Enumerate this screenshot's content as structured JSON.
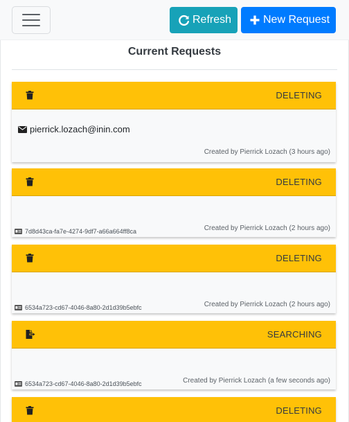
{
  "header": {
    "refresh_label": "Refresh",
    "new_request_label": "New Request"
  },
  "page": {
    "title": "Current Requests"
  },
  "colors": {
    "refresh": "#17a2b8",
    "new_request": "#007bff",
    "card_header": "#ffc107"
  },
  "requests": [
    {
      "status": "DELETING",
      "icon": "trash-icon",
      "email": "pierrick.lozach@inin.com",
      "id": "",
      "created": "Created by Pierrick Lozach (3 hours ago)"
    },
    {
      "status": "DELETING",
      "icon": "trash-icon",
      "email": "",
      "id": "7d8d43ca-fa7e-4274-9df7-a66a664ff8ca",
      "created": "Created by Pierrick Lozach (2 hours ago)"
    },
    {
      "status": "DELETING",
      "icon": "trash-icon",
      "email": "",
      "id": "6534a723-cd67-4046-8a80-2d1d39b5ebfc",
      "created": "Created by Pierrick Lozach (2 hours ago)"
    },
    {
      "status": "SEARCHING",
      "icon": "file-export-icon",
      "email": "",
      "id": "6534a723-cd67-4046-8a80-2d1d39b5ebfc",
      "created": "Created by Pierrick Lozach (a few seconds ago)"
    },
    {
      "status": "DELETING",
      "icon": "trash-icon",
      "email": "",
      "id": "",
      "created": ""
    }
  ]
}
